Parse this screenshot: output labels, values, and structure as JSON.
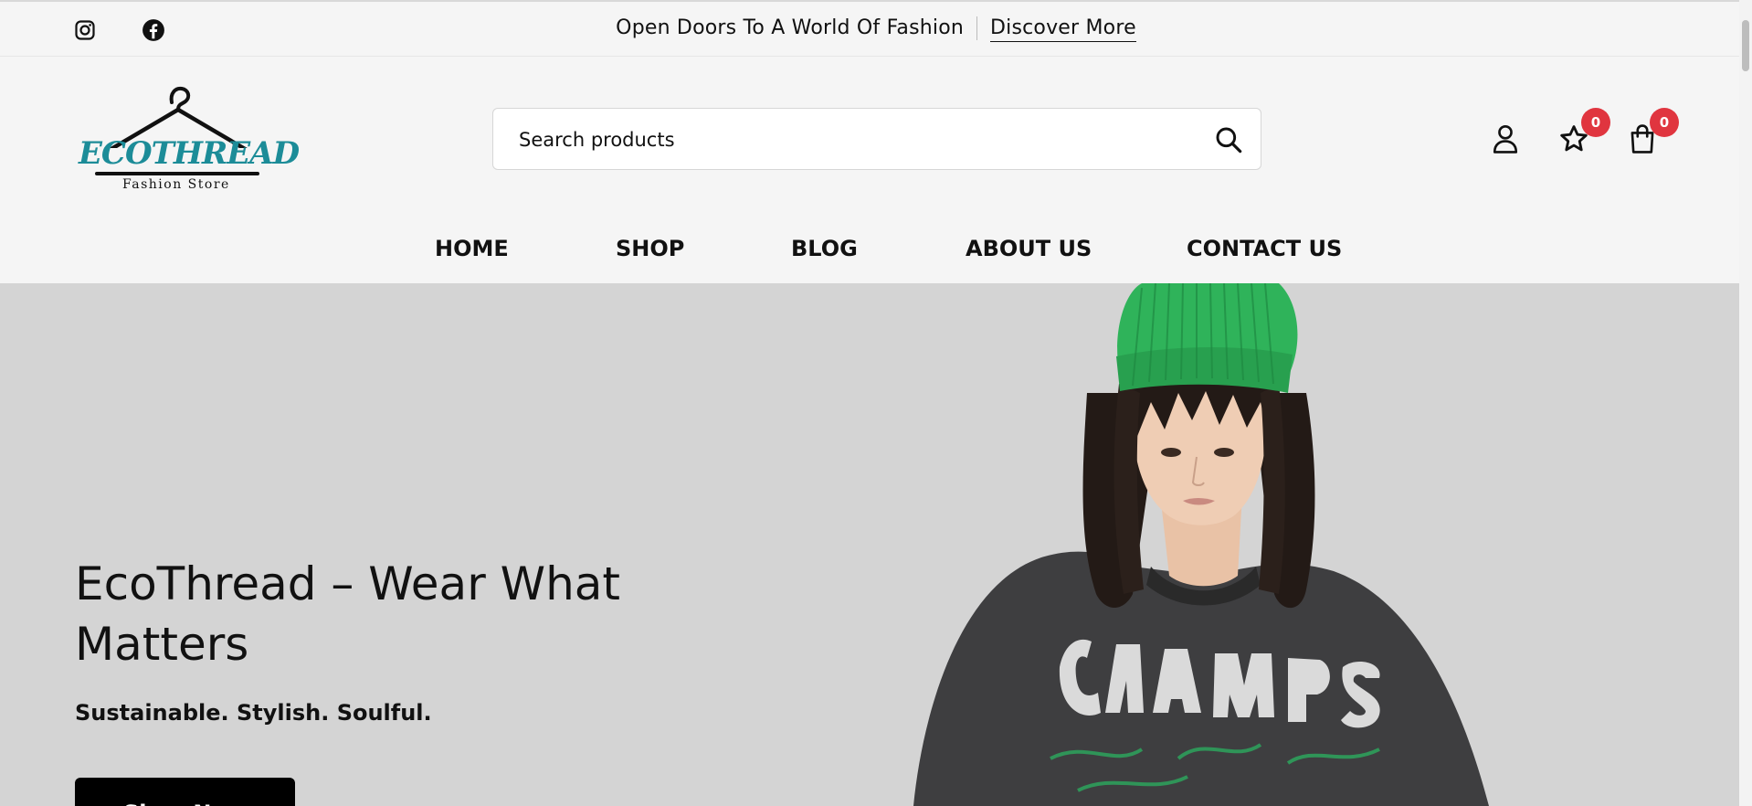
{
  "topbar": {
    "social": [
      {
        "icon": "instagram-icon"
      },
      {
        "icon": "facebook-icon"
      }
    ],
    "promo_text": "Open Doors To A World Of Fashion",
    "promo_link": "Discover More"
  },
  "header": {
    "logo": {
      "wordmark": "ECOTHREAD",
      "tagline": "Fashion Store",
      "color": "#1c8c98"
    },
    "search": {
      "placeholder": "Search products",
      "value": ""
    },
    "icons": {
      "account": "user-icon",
      "wishlist": {
        "icon": "star-icon",
        "count": "0"
      },
      "cart": {
        "icon": "bag-icon",
        "count": "0"
      }
    },
    "badge_color": "#e0353f"
  },
  "nav": [
    {
      "label": "HOME"
    },
    {
      "label": "SHOP"
    },
    {
      "label": "BLOG"
    },
    {
      "label": "ABOUT US"
    },
    {
      "label": "CONTACT US"
    }
  ],
  "hero": {
    "title": "EcoThread – Wear What Matters",
    "subtitle": "Sustainable. Stylish. Soulful.",
    "cta": "Shop Now",
    "background": "#d4d4d4",
    "beanie_color": "#2fb35a"
  }
}
